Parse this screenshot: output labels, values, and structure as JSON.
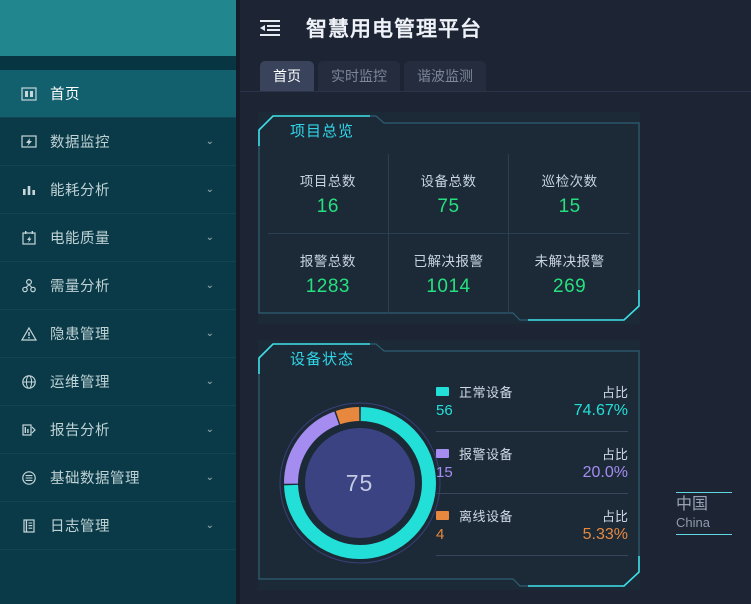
{
  "sidebar": {
    "logo_area": "",
    "items": [
      {
        "label": "首页",
        "icon": "home-icon",
        "active": true,
        "arrow": false
      },
      {
        "label": "数据监控",
        "icon": "monitor-icon",
        "active": false,
        "arrow": true
      },
      {
        "label": "能耗分析",
        "icon": "bar-chart-icon",
        "active": false,
        "arrow": true
      },
      {
        "label": "电能质量",
        "icon": "calendar-icon",
        "active": false,
        "arrow": true
      },
      {
        "label": "需量分析",
        "icon": "branch-icon",
        "active": false,
        "arrow": true
      },
      {
        "label": "隐患管理",
        "icon": "warning-icon",
        "active": false,
        "arrow": true
      },
      {
        "label": "运维管理",
        "icon": "globe-icon",
        "active": false,
        "arrow": true
      },
      {
        "label": "报告分析",
        "icon": "report-icon",
        "active": false,
        "arrow": true
      },
      {
        "label": "基础数据管理",
        "icon": "database-icon",
        "active": false,
        "arrow": true
      },
      {
        "label": "日志管理",
        "icon": "log-icon",
        "active": false,
        "arrow": true
      }
    ],
    "arrow_glyph": "⌄"
  },
  "header": {
    "fold_icon": "menu-fold-icon",
    "title": "智慧用电管理平台"
  },
  "tabs": [
    {
      "label": "首页",
      "active": true
    },
    {
      "label": "实时监控",
      "active": false
    },
    {
      "label": "谐波监测",
      "active": false
    }
  ],
  "overview_panel": {
    "title": "项目总览",
    "stats": [
      {
        "label": "项目总数",
        "value": "16"
      },
      {
        "label": "设备总数",
        "value": "75"
      },
      {
        "label": "巡检次数",
        "value": "15"
      },
      {
        "label": "报警总数",
        "value": "1283"
      },
      {
        "label": "已解决报警",
        "value": "1014"
      },
      {
        "label": "未解决报警",
        "value": "269"
      }
    ]
  },
  "status_panel": {
    "title": "设备状态",
    "donut_center": "75",
    "ratio_label": "占比",
    "legend": [
      {
        "name": "正常设备",
        "count": "56",
        "percent": "74.67%",
        "color": "#22e0d8"
      },
      {
        "name": "报警设备",
        "count": "15",
        "percent": "20.0%",
        "color": "#a48cf0"
      },
      {
        "name": "离线设备",
        "count": "4",
        "percent": "5.33%",
        "color": "#e8883e"
      }
    ]
  },
  "chart_data": {
    "type": "pie",
    "title": "设备状态",
    "categories": [
      "正常设备",
      "报警设备",
      "离线设备"
    ],
    "values": [
      56,
      15,
      4
    ],
    "percentages": [
      74.67,
      20.0,
      5.33
    ],
    "total": 75,
    "colors": [
      "#22e0d8",
      "#a48cf0",
      "#e8883e"
    ],
    "legend": "right",
    "donut": true,
    "center_label": "75"
  },
  "china_badge": {
    "cn": "中国",
    "en": "China"
  },
  "colors": {
    "page_bg": "#1d2434",
    "sidebar_bg": "#0a3a47",
    "sidebar_active": "#12606e",
    "logo_bg": "#22868f",
    "panel_bg": "#1c2a38",
    "panel_border": "#2e5f72",
    "accent_cyan": "#2fd6e8",
    "stat_green": "#26e07f"
  }
}
